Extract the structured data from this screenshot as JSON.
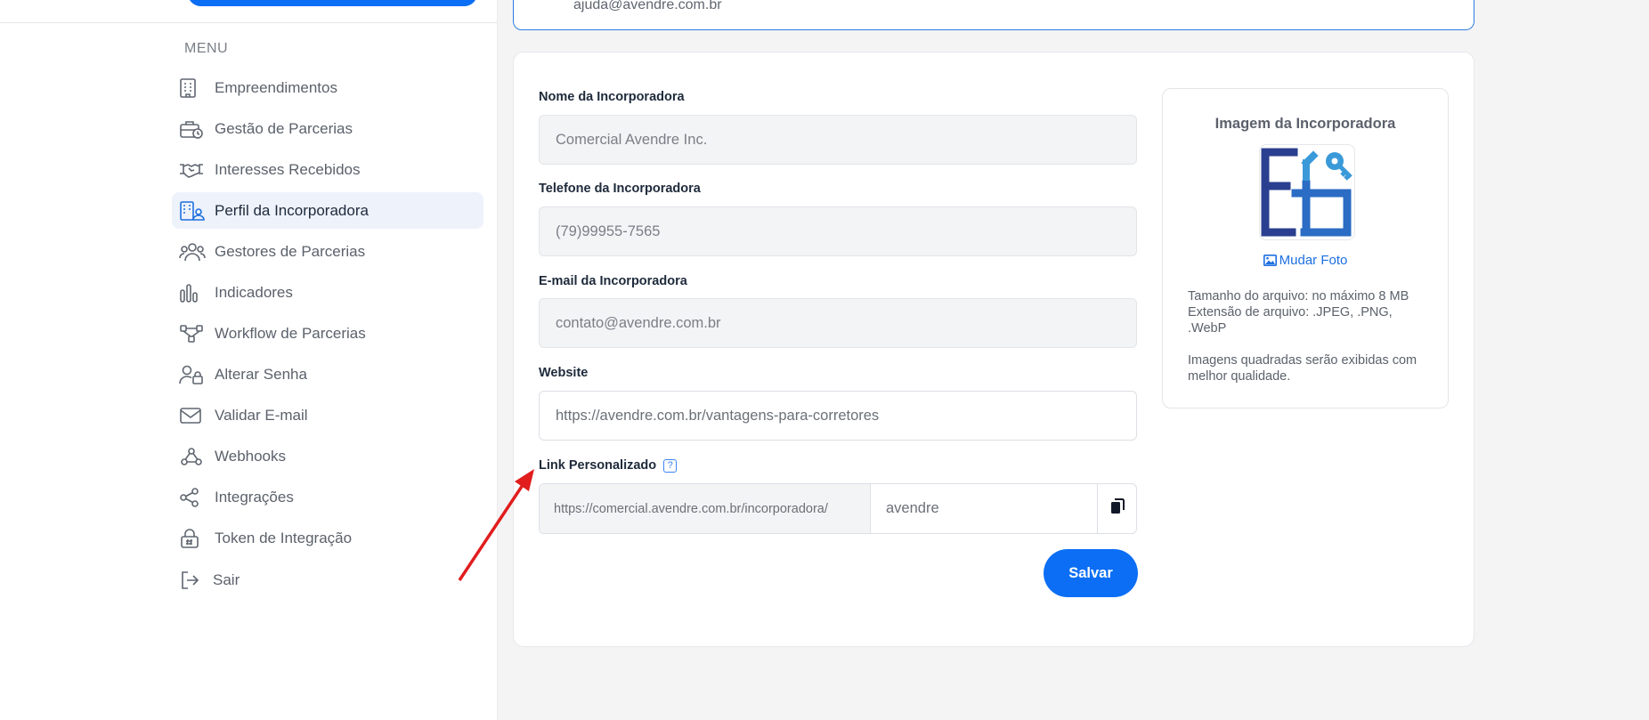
{
  "sidebar": {
    "menu_title": "MENU",
    "items": [
      {
        "label": "Empreendimentos",
        "icon": "building-icon"
      },
      {
        "label": "Gestão de Parcerias",
        "icon": "briefcase-clock-icon"
      },
      {
        "label": "Interesses Recebidos",
        "icon": "handshake-icon"
      },
      {
        "label": "Perfil da Incorporadora",
        "icon": "building-user-icon",
        "active": true
      },
      {
        "label": "Gestores de Parcerias",
        "icon": "users-icon"
      },
      {
        "label": "Indicadores",
        "icon": "bar-chart-icon"
      },
      {
        "label": "Workflow de Parcerias",
        "icon": "workflow-icon"
      },
      {
        "label": "Alterar Senha",
        "icon": "user-lock-icon"
      },
      {
        "label": "Validar E-mail",
        "icon": "envelope-icon"
      },
      {
        "label": "Webhooks",
        "icon": "webhook-icon"
      },
      {
        "label": "Integrações",
        "icon": "share-icon"
      },
      {
        "label": "Token de Integração",
        "icon": "lock-hash-icon"
      }
    ],
    "logout_label": "Sair"
  },
  "top_card": {
    "email": "ajuda@avendre.com.br"
  },
  "form": {
    "name_label": "Nome da Incorporadora",
    "name_value": "Comercial Avendre Inc.",
    "phone_label": "Telefone da Incorporadora",
    "phone_value": "(79)99955-7565",
    "email_label": "E-mail da Incorporadora",
    "email_value": "contato@avendre.com.br",
    "website_label": "Website",
    "website_value": "https://avendre.com.br/vantagens-para-corretores",
    "link_label": "Link Personalizado",
    "link_help": "?",
    "link_prefix": "https://comercial.avendre.com.br/incorporadora/",
    "link_slug": "avendre",
    "save_label": "Salvar"
  },
  "image_panel": {
    "title": "Imagem da Incorporadora",
    "change_photo": "Mudar Foto",
    "size_info": "Tamanho do arquivo: no máximo 8 MB",
    "ext_info": "Extensão de arquivo: .JPEG, .PNG, .WebP",
    "quality_info": "Imagens quadradas serão exibidas com melhor qualidade."
  },
  "colors": {
    "primary": "#0b6ef5",
    "annotation_arrow": "#e11d1d",
    "logo_dark": "#2a3f8f",
    "logo_light": "#3a9ad9"
  }
}
